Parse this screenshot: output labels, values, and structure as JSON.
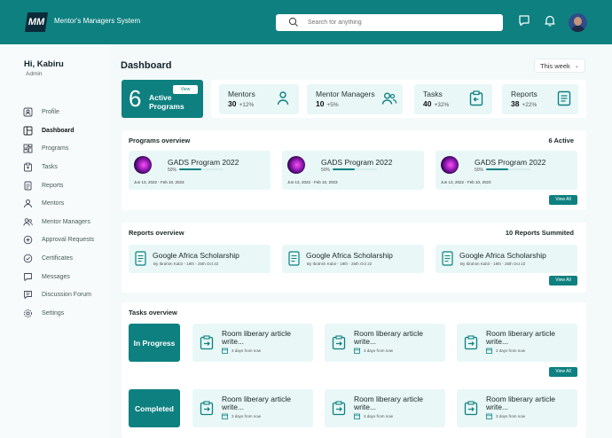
{
  "header": {
    "logo_text": "MM",
    "app_title": "Mentor's Managers System",
    "search_placeholder": "Search for anything",
    "icons": [
      "chat-icon",
      "bell-icon",
      "user-avatar"
    ]
  },
  "sidebar": {
    "greeting": "Hi, Kabiru",
    "role": "Admin",
    "items": [
      {
        "label": "Profile",
        "icon": "profile-icon",
        "active": false
      },
      {
        "label": "Dashboard",
        "icon": "dashboard-icon",
        "active": true
      },
      {
        "label": "Programs",
        "icon": "programs-icon",
        "active": false
      },
      {
        "label": "Tasks",
        "icon": "tasks-icon",
        "active": false
      },
      {
        "label": "Reports",
        "icon": "reports-icon",
        "active": false
      },
      {
        "label": "Mentors",
        "icon": "mentors-icon",
        "active": false
      },
      {
        "label": "Mentor Managers",
        "icon": "mentor-managers-icon",
        "active": false
      },
      {
        "label": "Approval Requests",
        "icon": "approval-icon",
        "active": false
      },
      {
        "label": "Certificates",
        "icon": "certificate-icon",
        "active": false
      },
      {
        "label": "Messages",
        "icon": "messages-icon",
        "active": false
      },
      {
        "label": "Discussion Forum",
        "icon": "forum-icon",
        "active": false
      },
      {
        "label": "Settings",
        "icon": "settings-icon",
        "active": false
      }
    ]
  },
  "main": {
    "title": "Dashboard",
    "period": "This week",
    "active_programs": {
      "count": "6",
      "label": "Active Programs",
      "view_label": "View"
    },
    "stats": [
      {
        "title": "Mentors",
        "value": "30",
        "change": "+12%"
      },
      {
        "title": "Mentor Managers",
        "value": "10",
        "change": "+5%"
      },
      {
        "title": "Tasks",
        "value": "40",
        "change": "+32%"
      },
      {
        "title": "Reports",
        "value": "38",
        "change": "+22%"
      }
    ],
    "programs_overview": {
      "title": "Programs overview",
      "summary": "6 Active",
      "view_all": "View All",
      "items": [
        {
          "name": "GADS Program 2022",
          "percent_label": "50%",
          "progress": 0.5,
          "dates": "Jun 13, 2022 - Feb 10, 2023"
        },
        {
          "name": "GADS Program 2022",
          "percent_label": "50%",
          "progress": 0.5,
          "dates": "Jun 13, 2022 - Feb 10, 2023"
        },
        {
          "name": "GADS Program 2022",
          "percent_label": "50%",
          "progress": 0.5,
          "dates": "Jun 13, 2022 - Feb 10, 2023"
        }
      ]
    },
    "reports_overview": {
      "title": "Reports overview",
      "summary": "10 Reports Summited",
      "view_all": "View All",
      "items": [
        {
          "name": "Google Africa Scholarship",
          "meta": "By Ibrahim Kabir - 19th - 25th Oct 22"
        },
        {
          "name": "Google Africa Scholarship",
          "meta": "By Ibrahim Kabir - 19th - 25th Oct 22"
        },
        {
          "name": "Google Africa Scholarship",
          "meta": "By Ibrahim Kabir - 19th - 25th Oct 22"
        }
      ]
    },
    "tasks_overview": {
      "title": "Tasks overview",
      "view_all": "View All",
      "in_progress_label": "In Progress",
      "completed_label": "Completed",
      "in_progress": [
        {
          "name": "Room liberary article write...",
          "due": "3 days from now"
        },
        {
          "name": "Room liberary article write...",
          "due": "3 days from now"
        },
        {
          "name": "Room liberary article write...",
          "due": "3 days from now"
        }
      ],
      "completed": [
        {
          "name": "Room liberary article write...",
          "due": "3 days from now"
        },
        {
          "name": "Room liberary article write...",
          "due": "3 days from now"
        },
        {
          "name": "Room liberary article write...",
          "due": "3 days from now"
        }
      ]
    }
  },
  "colors": {
    "primary": "#0e8080",
    "card_bg": "#e9f7f7",
    "page_bg": "#f4fafa"
  }
}
